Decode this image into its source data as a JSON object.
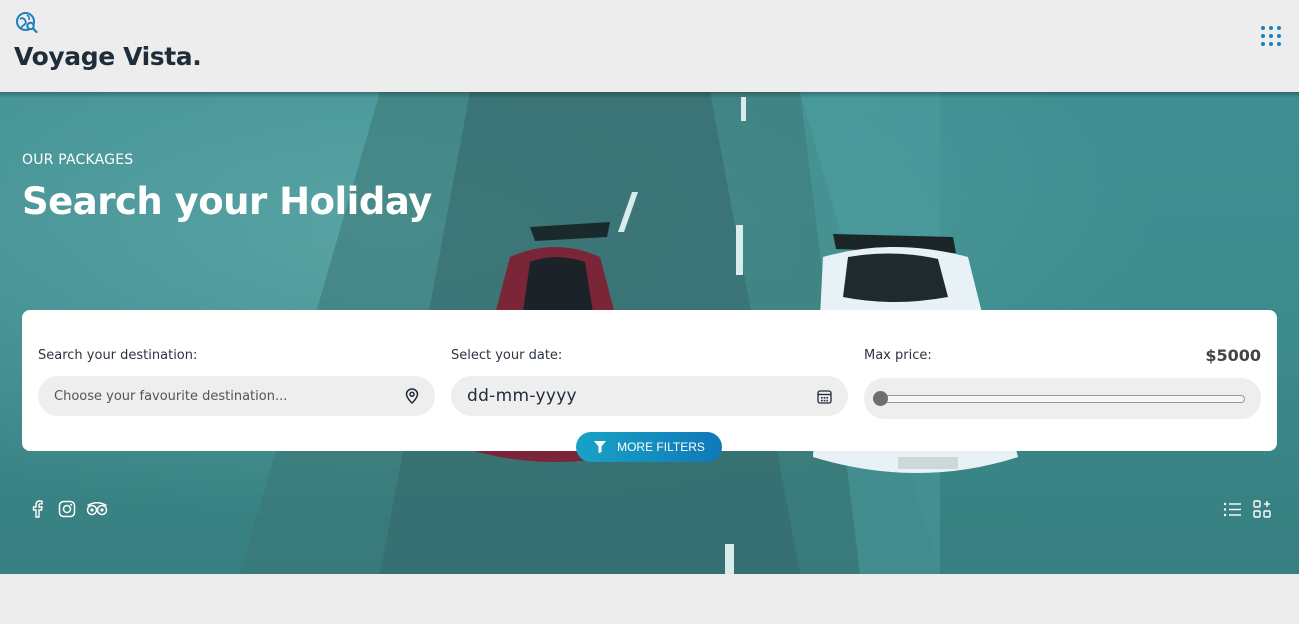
{
  "brand": {
    "name": "Voyage Vista.",
    "logo_icon": "globe-search-icon"
  },
  "header": {
    "menu_icon": "grid-dots-icon"
  },
  "hero": {
    "eyebrow": "OUR PACKAGES",
    "title": "Search your Holiday"
  },
  "search": {
    "destination": {
      "label": "Search your destination:",
      "placeholder": "Choose your favourite destination...",
      "icon": "map-pin-icon"
    },
    "date": {
      "label": "Select your date:",
      "value": "dd-mm-yyyy",
      "icon": "calendar-icon"
    },
    "price": {
      "label": "Max price:",
      "value": "$5000",
      "slider_fraction": 0
    },
    "more_filters": {
      "label": "MORE FILTERS",
      "icon": "filter-icon"
    }
  },
  "social": [
    "facebook-icon",
    "instagram-icon",
    "tripadvisor-icon"
  ],
  "view_options": [
    "list-view-icon",
    "grid-view-icon"
  ],
  "colors": {
    "accent": "#1d7fc0",
    "button_start": "#19a3c5",
    "button_end": "#0f78b9",
    "dark_text": "#1f2d3a"
  }
}
